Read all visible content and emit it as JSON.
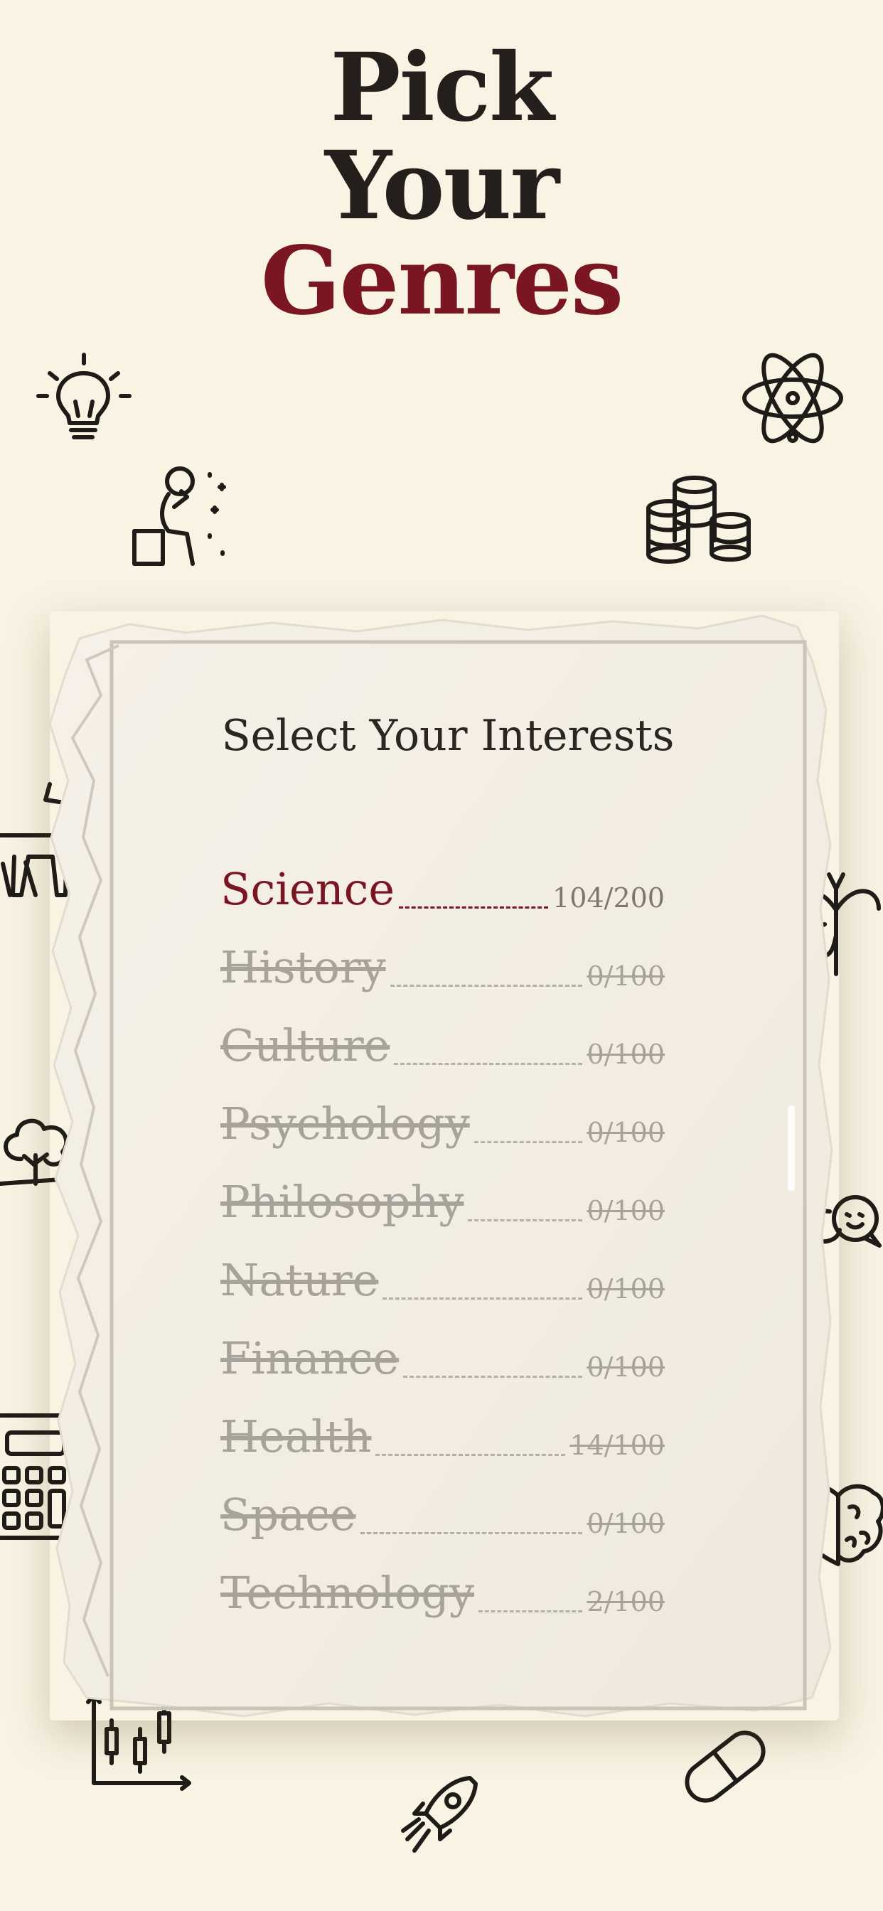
{
  "header": {
    "line1": "Pick",
    "line2": "Your",
    "line3": "Genres"
  },
  "card": {
    "title": "Select Your Interests"
  },
  "genres": [
    {
      "name": "Science",
      "count": "104/200",
      "selected": true
    },
    {
      "name": "History",
      "count": "0/100",
      "selected": false
    },
    {
      "name": "Culture",
      "count": "0/100",
      "selected": false
    },
    {
      "name": "Psychology",
      "count": "0/100",
      "selected": false
    },
    {
      "name": "Philosophy",
      "count": "0/100",
      "selected": false
    },
    {
      "name": "Nature",
      "count": "0/100",
      "selected": false
    },
    {
      "name": "Finance",
      "count": "0/100",
      "selected": false
    },
    {
      "name": "Health",
      "count": "14/100",
      "selected": false
    },
    {
      "name": "Space",
      "count": "0/100",
      "selected": false
    },
    {
      "name": "Technology",
      "count": "2/100",
      "selected": false
    }
  ],
  "icons": [
    "lightbulb-icon",
    "atom-icon",
    "thinker-icon",
    "coins-icon",
    "deer-icon",
    "butterfly-icon",
    "tree-icon",
    "chat-bubbles-icon",
    "calculator-icon",
    "heart-brain-icon",
    "chart-icon",
    "rocket-icon",
    "pill-icon"
  ],
  "colors": {
    "background": "#f8f3e3",
    "accent": "#7a1622",
    "ink": "#241f1c",
    "paper": "#f3eee4",
    "muted": "#a7a29a"
  }
}
